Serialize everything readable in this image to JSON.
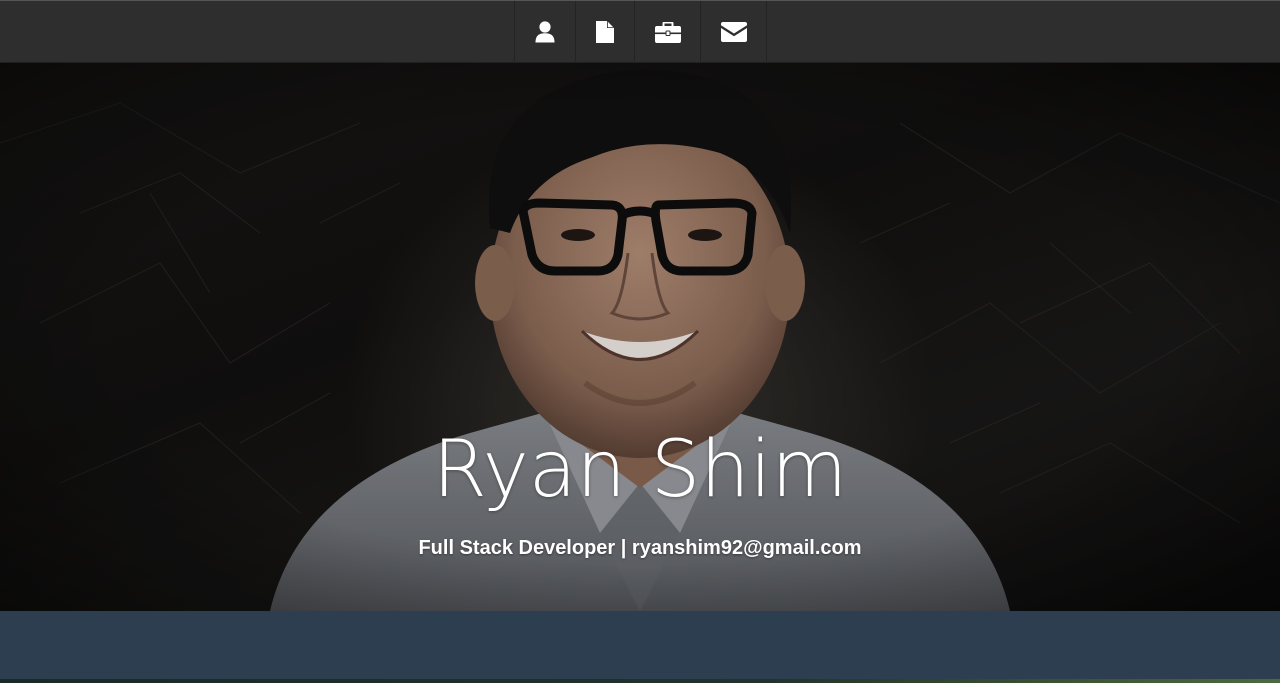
{
  "nav": {
    "items": [
      {
        "icon": "user-icon",
        "label": ""
      },
      {
        "icon": "document-icon",
        "label": ""
      },
      {
        "icon": "briefcase-icon",
        "label": ""
      },
      {
        "icon": "envelope-icon",
        "label": ""
      }
    ],
    "background": "#2e2e2e",
    "icon_color": "#ffffff"
  },
  "hero": {
    "name": "Ryan Shim",
    "tagline": "Full Stack Developer | ryanshim92@gmail.com",
    "photo": "portrait-photo"
  },
  "colors": {
    "band": "#2c3e50",
    "text": "#ffffff"
  }
}
